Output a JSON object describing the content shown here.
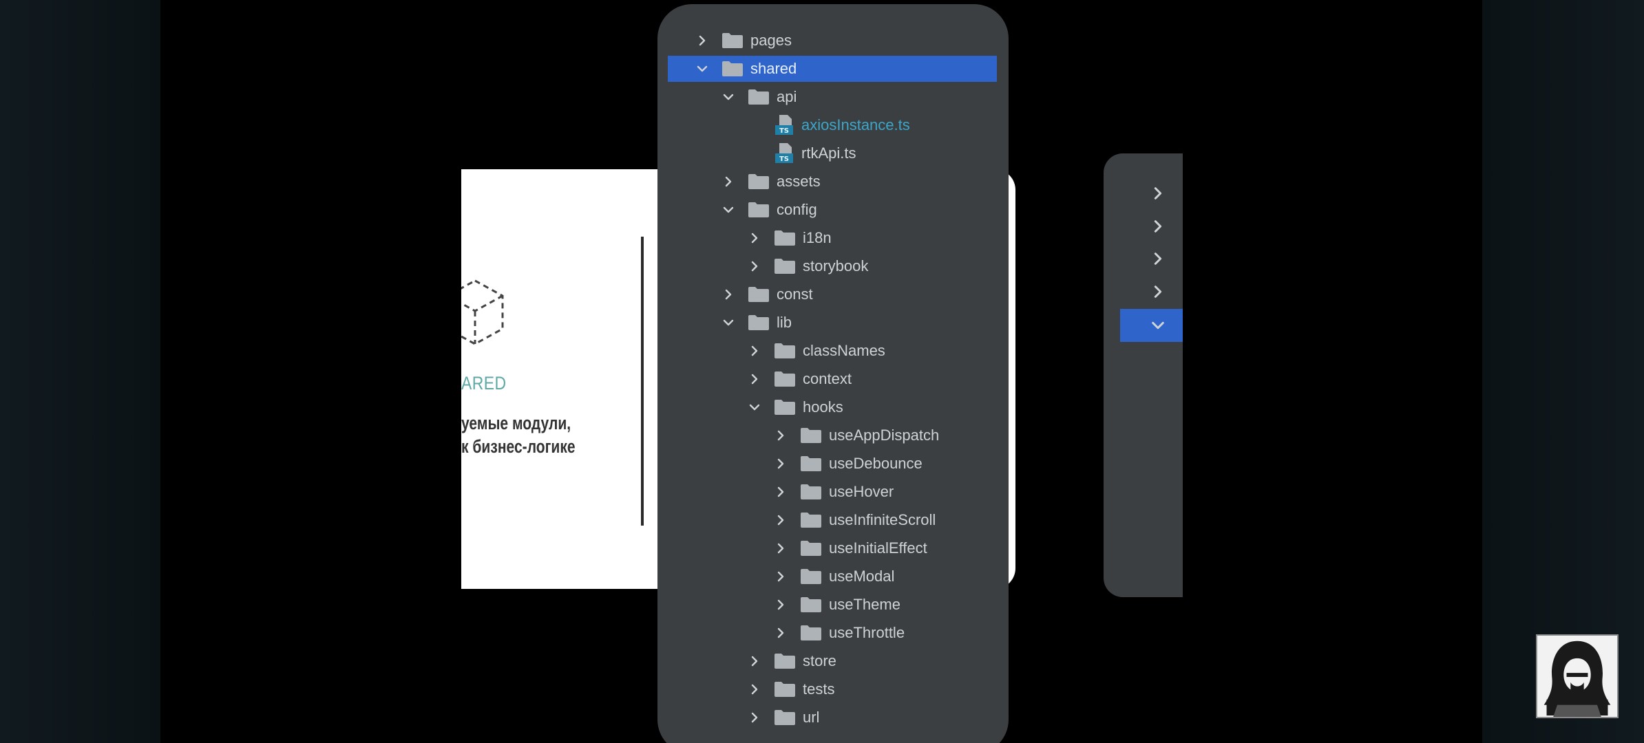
{
  "slide": {
    "heading": "ARED",
    "description_line1": "уемые модули,",
    "description_line2": "к бизнес-логике"
  },
  "tree": {
    "items": [
      {
        "label": "pages",
        "type": "folder",
        "depth": 0,
        "expanded": false,
        "selected": false
      },
      {
        "label": "shared",
        "type": "folder",
        "depth": 0,
        "expanded": true,
        "selected": true
      },
      {
        "label": "api",
        "type": "folder",
        "depth": 1,
        "expanded": true,
        "selected": false
      },
      {
        "label": "axiosInstance.ts",
        "type": "file-ts",
        "depth": 2,
        "expanded": null,
        "selected": false,
        "highlight": true
      },
      {
        "label": "rtkApi.ts",
        "type": "file-ts",
        "depth": 2,
        "expanded": null,
        "selected": false,
        "highlight": false
      },
      {
        "label": "assets",
        "type": "folder",
        "depth": 1,
        "expanded": false,
        "selected": false
      },
      {
        "label": "config",
        "type": "folder",
        "depth": 1,
        "expanded": true,
        "selected": false
      },
      {
        "label": "i18n",
        "type": "folder",
        "depth": 2,
        "expanded": false,
        "selected": false
      },
      {
        "label": "storybook",
        "type": "folder",
        "depth": 2,
        "expanded": false,
        "selected": false
      },
      {
        "label": "const",
        "type": "folder",
        "depth": 1,
        "expanded": false,
        "selected": false
      },
      {
        "label": "lib",
        "type": "folder",
        "depth": 1,
        "expanded": true,
        "selected": false
      },
      {
        "label": "classNames",
        "type": "folder",
        "depth": 2,
        "expanded": false,
        "selected": false
      },
      {
        "label": "context",
        "type": "folder",
        "depth": 2,
        "expanded": false,
        "selected": false
      },
      {
        "label": "hooks",
        "type": "folder",
        "depth": 2,
        "expanded": true,
        "selected": false
      },
      {
        "label": "useAppDispatch",
        "type": "folder",
        "depth": 3,
        "expanded": false,
        "selected": false
      },
      {
        "label": "useDebounce",
        "type": "folder",
        "depth": 3,
        "expanded": false,
        "selected": false
      },
      {
        "label": "useHover",
        "type": "folder",
        "depth": 3,
        "expanded": false,
        "selected": false
      },
      {
        "label": "useInfiniteScroll",
        "type": "folder",
        "depth": 3,
        "expanded": false,
        "selected": false
      },
      {
        "label": "useInitialEffect",
        "type": "folder",
        "depth": 3,
        "expanded": false,
        "selected": false
      },
      {
        "label": "useModal",
        "type": "folder",
        "depth": 3,
        "expanded": false,
        "selected": false
      },
      {
        "label": "useTheme",
        "type": "folder",
        "depth": 3,
        "expanded": false,
        "selected": false
      },
      {
        "label": "useThrottle",
        "type": "folder",
        "depth": 3,
        "expanded": false,
        "selected": false
      },
      {
        "label": "store",
        "type": "folder",
        "depth": 2,
        "expanded": false,
        "selected": false
      },
      {
        "label": "tests",
        "type": "folder",
        "depth": 2,
        "expanded": false,
        "selected": false
      },
      {
        "label": "url",
        "type": "folder",
        "depth": 2,
        "expanded": false,
        "selected": false
      }
    ]
  },
  "right_panel": {
    "rows": [
      {
        "expanded": false,
        "selected": false
      },
      {
        "expanded": false,
        "selected": false
      },
      {
        "expanded": false,
        "selected": false
      },
      {
        "expanded": false,
        "selected": false
      },
      {
        "expanded": true,
        "selected": true
      }
    ]
  },
  "icons": {
    "folder": "folder-icon",
    "ts_file": "typescript-file-icon",
    "chevron_right": "chevron-right-icon",
    "chevron_down": "chevron-down-icon",
    "avatar": "hooded-hacker-avatar-icon"
  },
  "colors": {
    "panel": "#3c3f41",
    "selection": "#2f65ca",
    "text": "#cfd3d6",
    "link": "#3aa6c9",
    "folder": "#aeb3b8",
    "accent_teal": "#5fa9a5"
  }
}
